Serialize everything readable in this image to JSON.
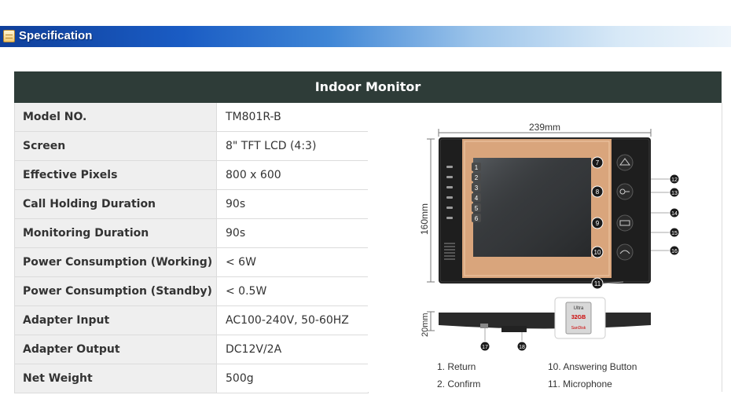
{
  "section": {
    "title": "Specification",
    "icon": "document-icon"
  },
  "table": {
    "title": "Indoor Monitor",
    "rows": [
      {
        "label": "Model NO.",
        "value": "TM801R-B"
      },
      {
        "label": "Screen",
        "value": "8\" TFT LCD (4:3)"
      },
      {
        "label": "Effective Pixels",
        "value": "800 x 600"
      },
      {
        "label": "Call Holding Duration",
        "value": "90s"
      },
      {
        "label": "Monitoring Duration",
        "value": "90s"
      },
      {
        "label": "Power Consumption (Working)",
        "value": "< 6W"
      },
      {
        "label": "Power Consumption (Standby)",
        "value": "< 0.5W"
      },
      {
        "label": "Adapter Input",
        "value": "AC100-240V, 50-60HZ"
      },
      {
        "label": "Adapter Output",
        "value": "DC12V/2A"
      },
      {
        "label": "Net Weight",
        "value": "500g"
      }
    ]
  },
  "diagram": {
    "width_label": "239mm",
    "height_label": "160mm",
    "depth_label": "20mm",
    "sd_card": {
      "brand": "SanDisk",
      "capacity": "32GB",
      "name": "Ultra"
    },
    "callouts_left": [
      "1",
      "2",
      "3",
      "4",
      "5",
      "6"
    ],
    "callouts_buttons": [
      "7",
      "8",
      "9",
      "10"
    ],
    "callout_mic": "11",
    "callouts_right": [
      "12",
      "13",
      "14",
      "15",
      "16"
    ],
    "callouts_bottom": [
      "17",
      "18"
    ],
    "legend": [
      {
        "text": "1. Return"
      },
      {
        "text": "10. Answering Button"
      },
      {
        "text": "2. Confirm"
      },
      {
        "text": "11. Microphone"
      }
    ],
    "colors": {
      "bezel": "#1e1e1e",
      "frame": "#d9a57c",
      "screen": "#3a3d40"
    }
  }
}
